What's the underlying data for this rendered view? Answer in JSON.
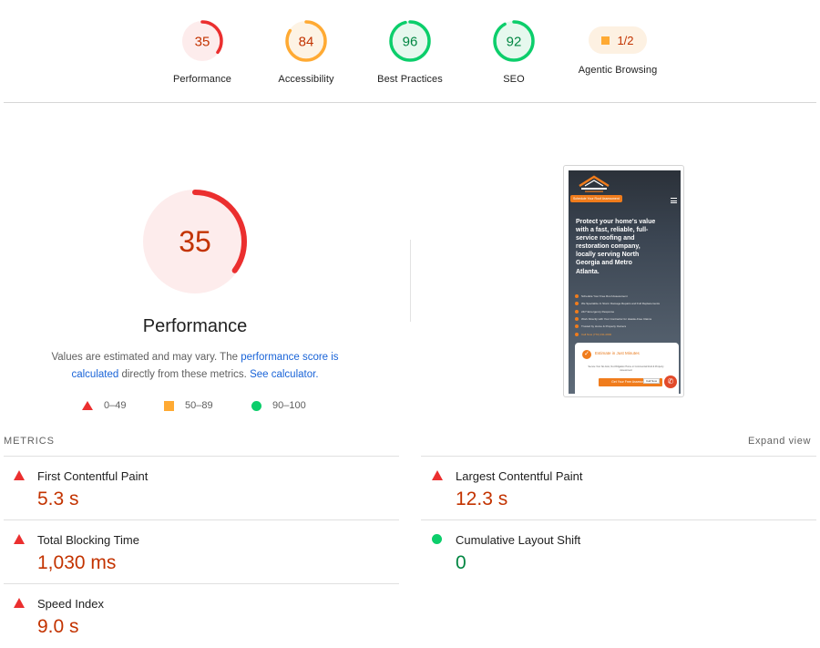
{
  "categories": [
    {
      "label": "Performance",
      "score": "35",
      "value": 35,
      "color": "#eb2f2f",
      "fill": "#fdecec",
      "text": "#c33300"
    },
    {
      "label": "Accessibility",
      "score": "84",
      "value": 84,
      "color": "#ffaa33",
      "fill": "#fdf3e4",
      "text": "#c33300"
    },
    {
      "label": "Best Practices",
      "score": "96",
      "value": 96,
      "color": "#0cce6b",
      "fill": "#e6f8ee",
      "text": "#018642"
    },
    {
      "label": "SEO",
      "score": "92",
      "value": 92,
      "color": "#0cce6b",
      "fill": "#e6f8ee",
      "text": "#018642"
    }
  ],
  "agentic": {
    "label": "Agentic Browsing",
    "score": "1/2"
  },
  "performance": {
    "title": "Performance",
    "score": "35",
    "value": 35,
    "desc_prefix": "Values are estimated and may vary. The ",
    "desc_link1": "performance score is calculated",
    "desc_mid": " directly from these metrics. ",
    "desc_link2": "See calculator."
  },
  "legend": {
    "fail": "0–49",
    "average": "50–89",
    "pass": "90–100"
  },
  "screenshot": {
    "cta": "Schedule Your Roof Assessment",
    "hero": "Protect your home's value with a fast, reliable, full-service roofing and restoration company, locally serving North Georgia and Metro Atlanta.",
    "bullets": [
      "Schedule Your Free Roof Assessment",
      "We Specialize In Storm Damage Repairs and Full Replacements",
      "24/7 Emergency Response",
      "Work Directly with Your Contractor for Hassle-Free Claims",
      "Trusted by Home & Property Owners",
      "Call Now (770) 231-0000"
    ],
    "card_title": "Estimate in Just Minutes",
    "card_text": "Secure Your No-Cost, No-Obligation Home or Commercial Roof & Property Assessment",
    "card_button": "Get Your Free Assessment",
    "call_now": "Call Now"
  },
  "metrics": {
    "heading": "METRICS",
    "expand": "Expand view",
    "items": [
      {
        "name": "First Contentful Paint",
        "value": "5.3 s",
        "status": "fail"
      },
      {
        "name": "Largest Contentful Paint",
        "value": "12.3 s",
        "status": "fail"
      },
      {
        "name": "Total Blocking Time",
        "value": "1,030 ms",
        "status": "fail"
      },
      {
        "name": "Cumulative Layout Shift",
        "value": "0",
        "status": "pass"
      },
      {
        "name": "Speed Index",
        "value": "9.0 s",
        "status": "fail"
      }
    ]
  }
}
